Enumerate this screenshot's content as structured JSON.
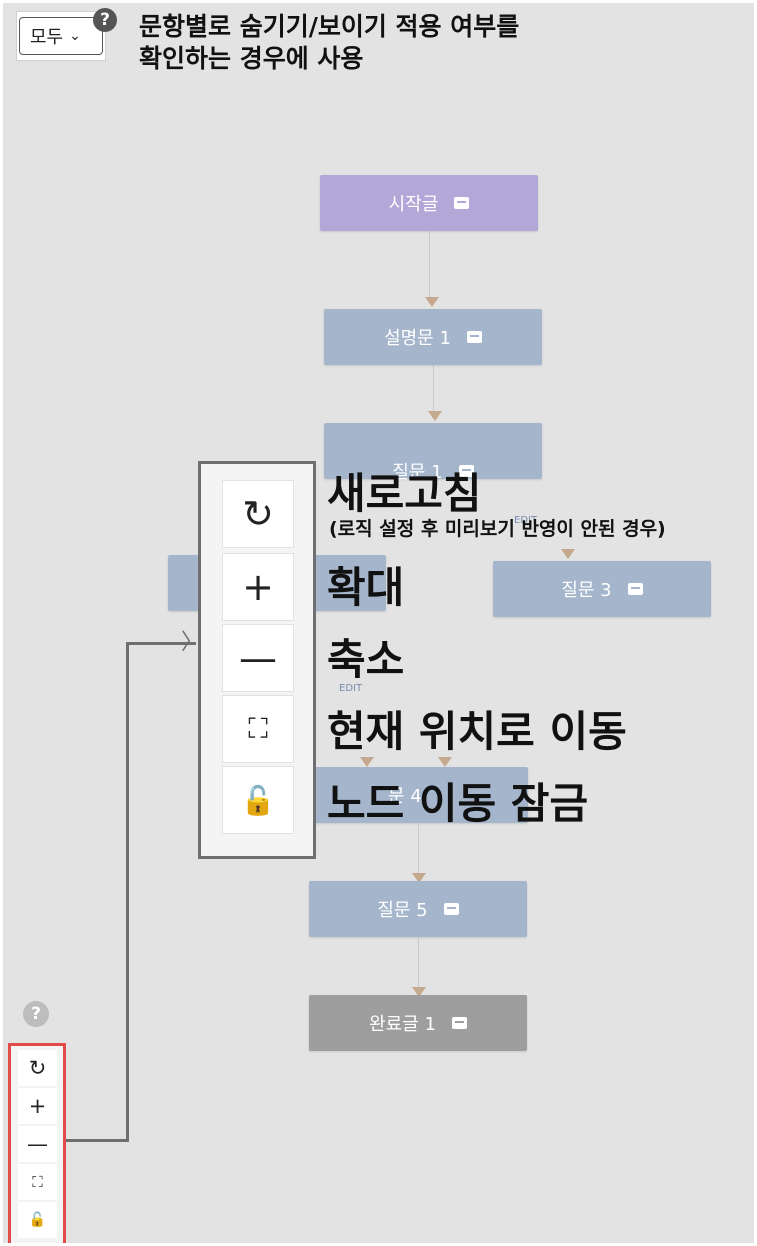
{
  "header": {
    "filter_value": "모두",
    "help_icon": "help-icon",
    "title_line1": "문항별로 숨기기/보이기 적용 여부를",
    "title_line2": "확인하는 경우에 사용"
  },
  "flow_nodes": {
    "start": "시작글",
    "desc1": "설명문 1",
    "q1": "질문 1",
    "q3": "질문 3",
    "q4_partial": "문 4",
    "q5": "질문 5",
    "end": "완료글 1",
    "edit_label": "EDIT"
  },
  "toolbar_callout": {
    "refresh_label": "새로고침",
    "refresh_note": "(로직 설정 후 미리보기 반영이 안된 경우)",
    "zoom_in_label": "확대",
    "zoom_out_label": "축소",
    "fit_label": "현재 위치로 이동",
    "lock_label": "노드 이동 잠금"
  },
  "icons": {
    "refresh": "refresh-icon",
    "zoom_in": "plus-icon",
    "zoom_out": "minus-icon",
    "fit": "fit-view-icon",
    "lock": "lock-icon",
    "comment": "comment-icon"
  },
  "colors": {
    "start_node": "#b2a7d6",
    "question_node": "#a4b5cc",
    "end_node": "#9e9e9e",
    "highlight": "#e34b4b"
  }
}
